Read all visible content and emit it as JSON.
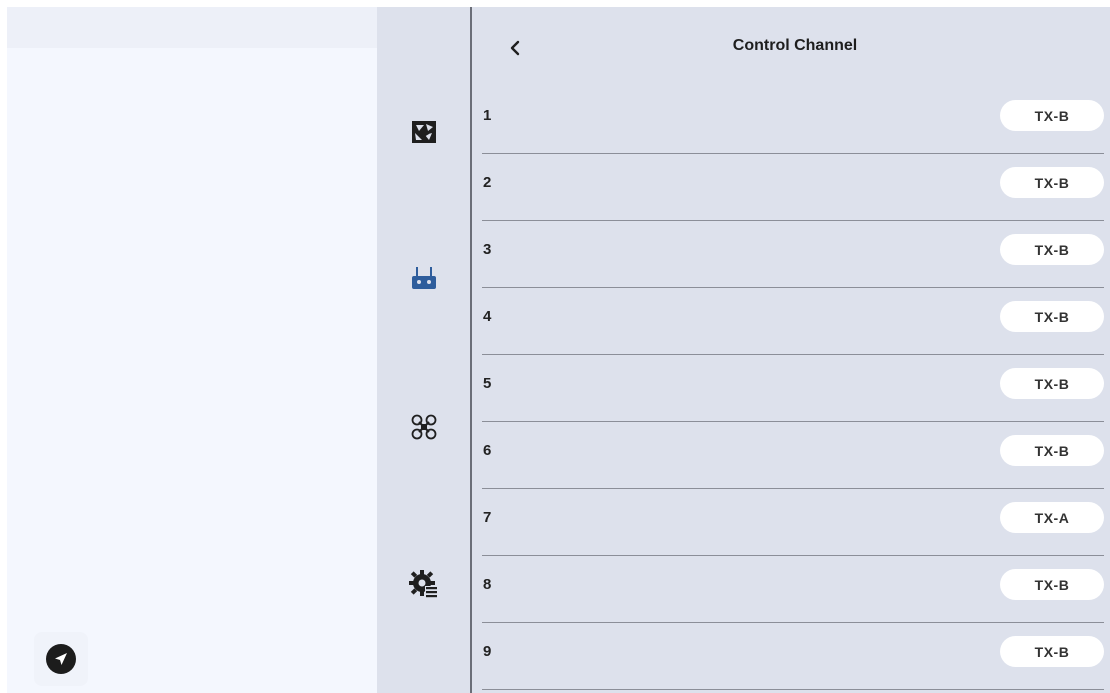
{
  "header": {
    "title": "Control Channel"
  },
  "rows": [
    {
      "number": "1",
      "value": "TX-B"
    },
    {
      "number": "2",
      "value": "TX-B"
    },
    {
      "number": "3",
      "value": "TX-B"
    },
    {
      "number": "4",
      "value": "TX-B"
    },
    {
      "number": "5",
      "value": "TX-B"
    },
    {
      "number": "6",
      "value": "TX-B"
    },
    {
      "number": "7",
      "value": "TX-A"
    },
    {
      "number": "8",
      "value": "TX-B"
    },
    {
      "number": "9",
      "value": "TX-B"
    }
  ],
  "nav_icons": [
    "camera-aperture-icon",
    "remote-controller-icon",
    "drone-icon",
    "settings-gear-icon"
  ],
  "left_pane_icons": [
    "send-icon"
  ],
  "colors": {
    "left_pane_bg": "#f4f7fe",
    "panel_bg": "#dde1ec",
    "pill_bg": "#ffffff",
    "accent_blue": "#2e5d9c",
    "divider": "#6b6e78"
  }
}
